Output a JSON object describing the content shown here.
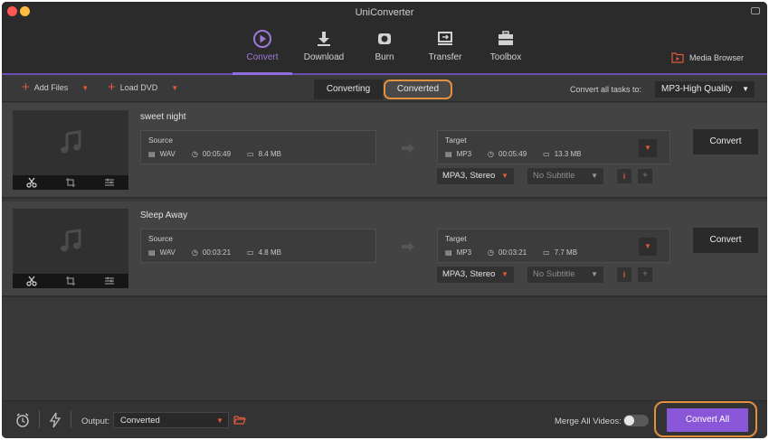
{
  "window": {
    "title": "UniConverter"
  },
  "nav": {
    "items": [
      {
        "label": "Convert",
        "icon": "convert-icon",
        "active": true
      },
      {
        "label": "Download",
        "icon": "download-icon",
        "active": false
      },
      {
        "label": "Burn",
        "icon": "burn-icon",
        "active": false
      },
      {
        "label": "Transfer",
        "icon": "transfer-icon",
        "active": false
      },
      {
        "label": "Toolbox",
        "icon": "toolbox-icon",
        "active": false
      }
    ],
    "media_browser": "Media Browser"
  },
  "toolbar": {
    "add_files": "Add Files",
    "load_dvd": "Load DVD",
    "tabs": {
      "converting": "Converting",
      "converted": "Converted"
    },
    "convert_all_label": "Convert all tasks to:",
    "quality": "MP3-High Quality"
  },
  "tasks": [
    {
      "name": "sweet night",
      "source": {
        "label": "Source",
        "format": "WAV",
        "duration": "00:05:49",
        "size": "8.4 MB"
      },
      "target": {
        "label": "Target",
        "format": "MP3",
        "duration": "00:05:49",
        "size": "13.3 MB"
      },
      "audio": "MPA3, Stereo",
      "subtitle": "No Subtitle",
      "convert_label": "Convert"
    },
    {
      "name": "Sleep Away",
      "source": {
        "label": "Source",
        "format": "WAV",
        "duration": "00:03:21",
        "size": "4.8 MB"
      },
      "target": {
        "label": "Target",
        "format": "MP3",
        "duration": "00:03:21",
        "size": "7.7 MB"
      },
      "audio": "MPA3, Stereo",
      "subtitle": "No Subtitle",
      "convert_label": "Convert"
    }
  ],
  "bottom": {
    "output_label": "Output:",
    "output_value": "Converted",
    "merge_label": "Merge All Videos:",
    "merge_enabled": false,
    "convert_all": "Convert All"
  },
  "colors": {
    "accent": "#8a56d8",
    "nav_active": "#9d7ad8",
    "highlight": "#e3903e",
    "icon_orange": "#e05a3a"
  }
}
